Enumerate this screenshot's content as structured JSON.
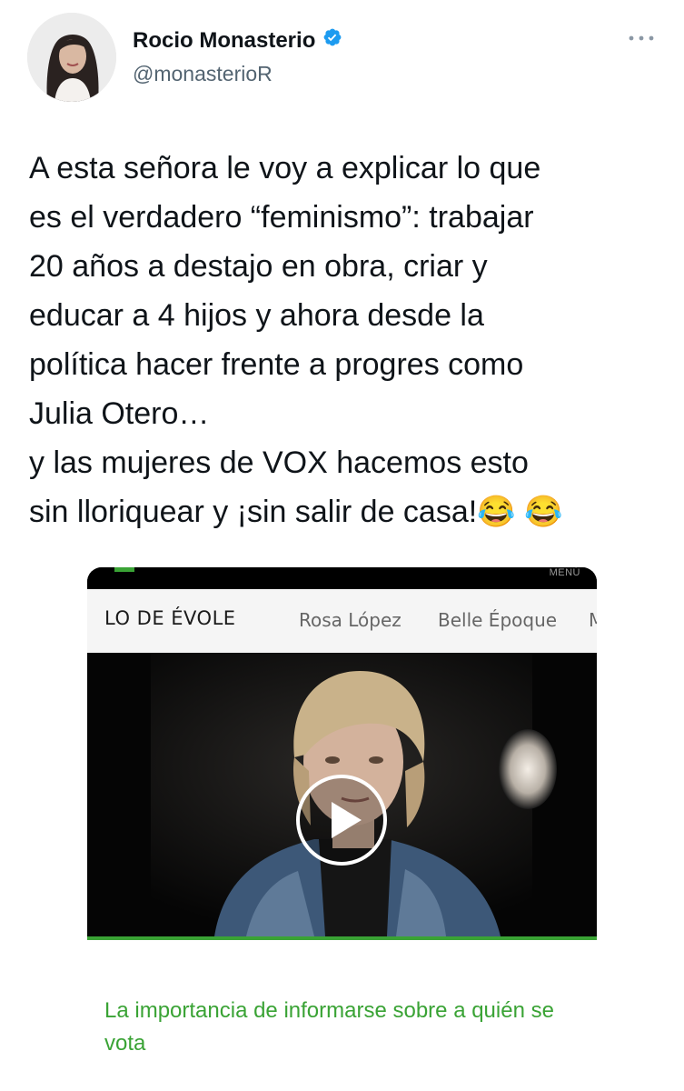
{
  "author": {
    "name": "Rocio Monasterio",
    "handle": "@monasterioR",
    "verified": true
  },
  "tweet": {
    "text": "A esta señora le voy a explicar lo que\nes el verdadero “feminismo”: trabajar\n20 años a destajo en obra, criar y\neducar a 4 hijos y ahora desde la\npolítica hacer frente a progres como\nJulia Otero…\ny las mujeres de VOX hacemos esto\nsin lloriquear y ¡sin salir de casa!",
    "emoji": "😂 😂"
  },
  "card": {
    "menu_label": "MENÚ",
    "brand": "LO DE ÉVOLE",
    "nav_links": [
      "Rosa López",
      "Belle Époque",
      "M"
    ],
    "caption": "La importancia de informarse sobre a quién se vota"
  },
  "icons": {
    "verified": "verified-badge-icon",
    "more": "more-options-icon",
    "play": "play-icon"
  },
  "colors": {
    "verified": "#1d9bf0",
    "accent_green": "#3aa335",
    "handle_gray": "#536471"
  }
}
